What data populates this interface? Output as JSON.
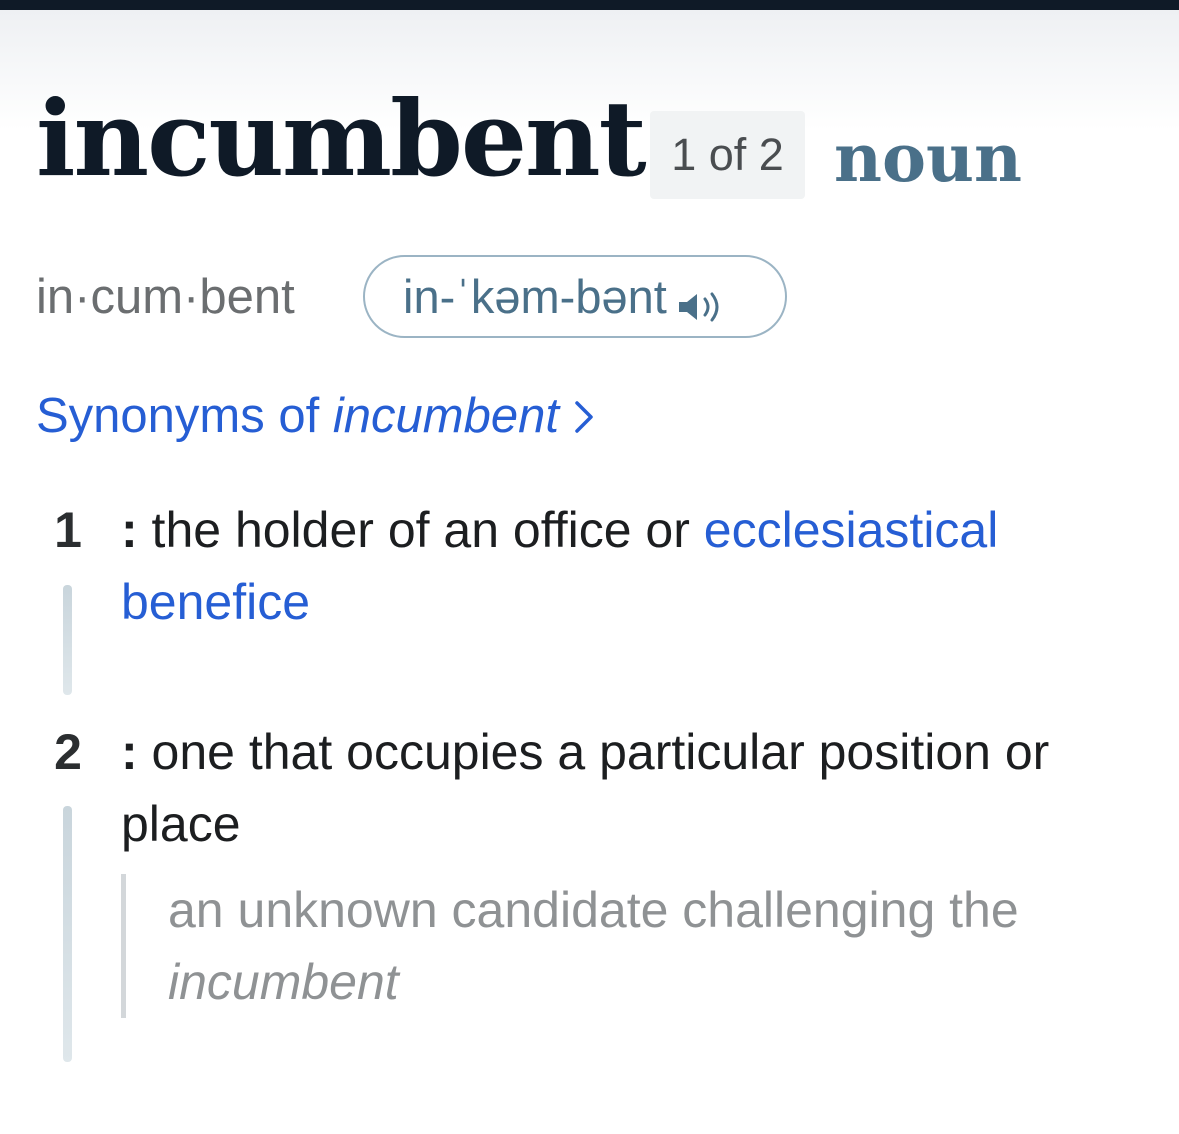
{
  "entry": {
    "headword": "incumbent",
    "homograph": "1 of 2",
    "part_of_speech": "noun",
    "syllables": "in·cum·bent",
    "pronunciation": "in-ˈkəm-bənt",
    "speaker_icon": "speaker-icon",
    "synonyms": {
      "prefix": "Synonyms of ",
      "word": "incumbent",
      "chevron_icon": "chevron-right-icon"
    }
  },
  "senses": [
    {
      "number": "1",
      "colon": ":",
      "text_before": " the holder of an office or ",
      "link": "ecclesiastical benefice"
    },
    {
      "number": "2",
      "colon": ":",
      "text": " one that occupies a particular position or place",
      "example_before": "an unknown candidate challenging the ",
      "example_italic": "incumbent"
    }
  ],
  "colors": {
    "link": "#265ed4",
    "part_of_speech": "#4a7089",
    "headword": "#0f1a27"
  }
}
